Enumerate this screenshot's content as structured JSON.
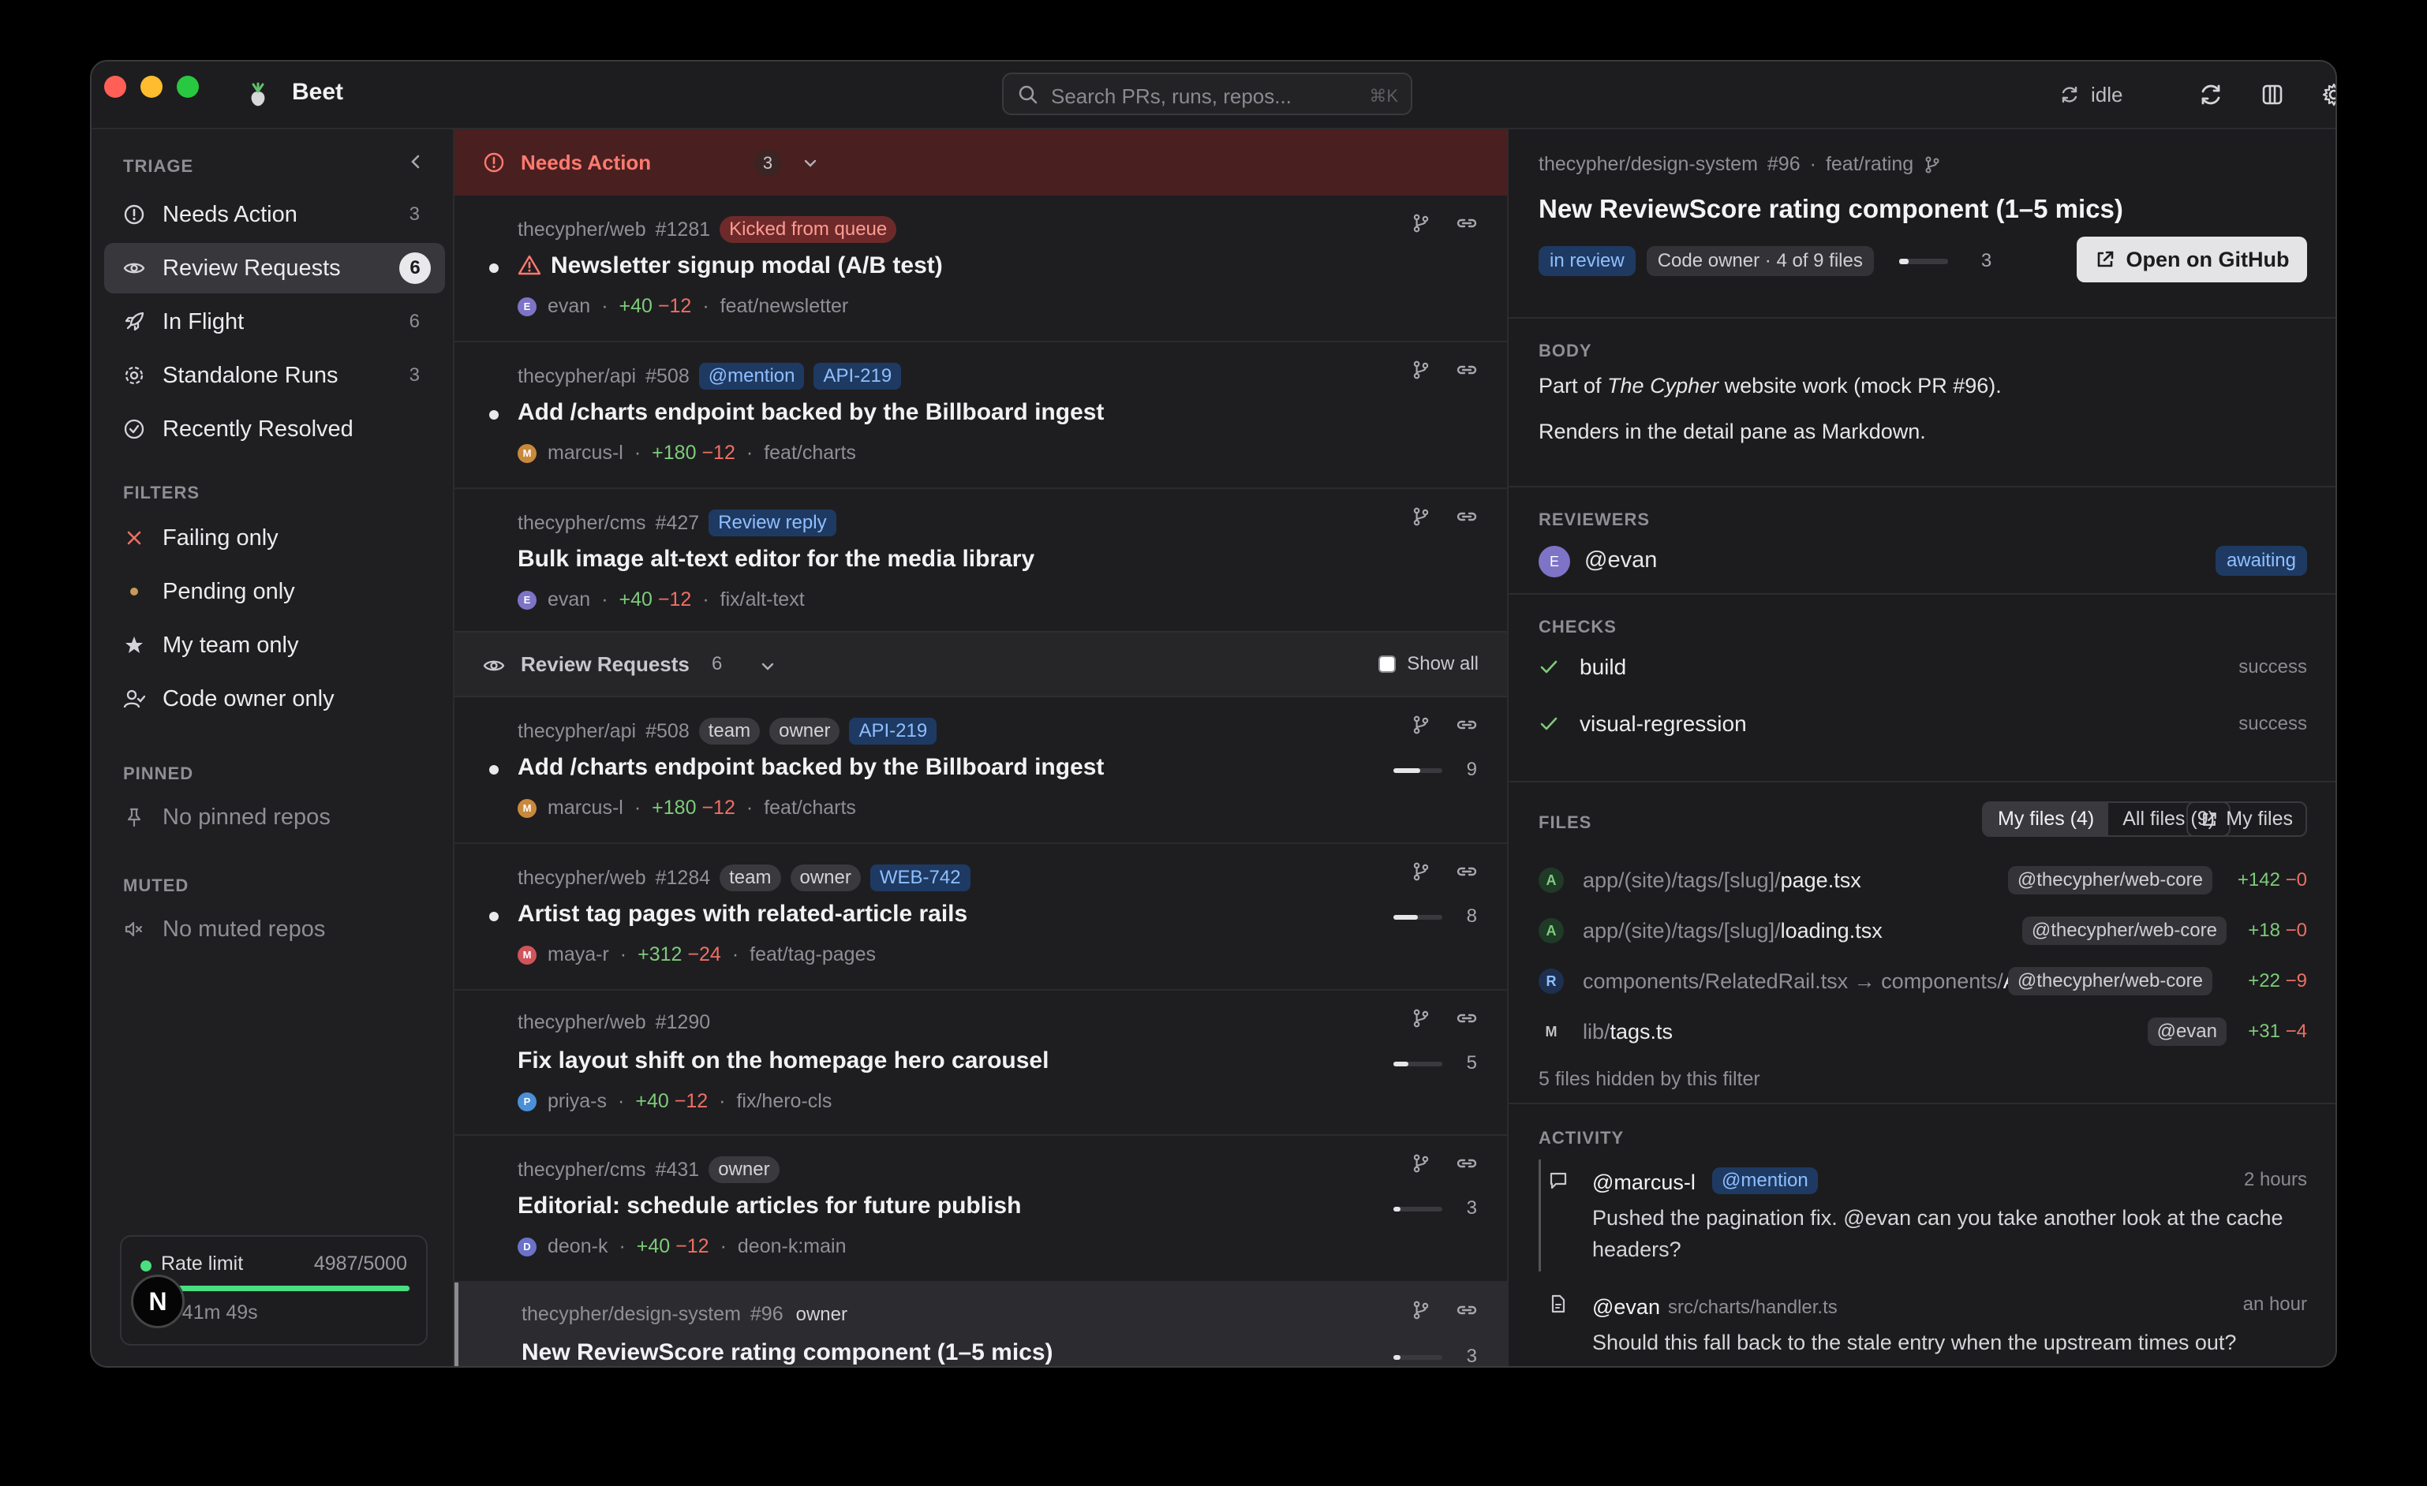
{
  "app": {
    "name": "Beet"
  },
  "search": {
    "placeholder": "Search PRs, runs, repos...",
    "shortcut": "⌘K"
  },
  "toolbar": {
    "status": "idle"
  },
  "sidebar": {
    "triage_title": "TRIAGE",
    "triage": [
      {
        "label": "Needs Action",
        "count": "3"
      },
      {
        "label": "Review Requests",
        "count": "6"
      },
      {
        "label": "In Flight",
        "count": "6"
      },
      {
        "label": "Standalone Runs",
        "count": "3"
      },
      {
        "label": "Recently Resolved",
        "count": ""
      }
    ],
    "filters_title": "FILTERS",
    "filters": [
      {
        "label": "Failing only"
      },
      {
        "label": "Pending only"
      },
      {
        "label": "My team only"
      },
      {
        "label": "Code owner only"
      }
    ],
    "pinned_title": "PINNED",
    "pinned_empty": "No pinned repos",
    "muted_title": "MUTED",
    "muted_empty": "No muted repos",
    "rate": {
      "label": "Rate limit",
      "value": "4987/5000",
      "used_fraction": 0.9974,
      "reset": "ts in 41m 49s",
      "avatar": "N"
    }
  },
  "list": {
    "needs_action": {
      "label": "Needs Action",
      "count": "3"
    },
    "needs_items": [
      {
        "repo": "thecypher/web",
        "num": "#1281",
        "tags": [
          {
            "text": "Kicked from queue",
            "kind": "red"
          }
        ],
        "title": "Newsletter signup modal (A/B test)",
        "author": "evan",
        "avatar": "E",
        "avatar_color": "#7d74c7",
        "plus": "+40",
        "minus": "−12",
        "branch": "feat/newsletter",
        "warn": true,
        "unread": true
      },
      {
        "repo": "thecypher/api",
        "num": "#508",
        "tags": [
          {
            "text": "@mention",
            "kind": "blue"
          },
          {
            "text": "API-219",
            "kind": "blue"
          }
        ],
        "title": "Add /charts endpoint backed by the Billboard ingest",
        "author": "marcus-l",
        "avatar": "M",
        "avatar_color": "#c9893c",
        "plus": "+180",
        "minus": "−12",
        "branch": "feat/charts",
        "unread": true
      },
      {
        "repo": "thecypher/cms",
        "num": "#427",
        "tags": [
          {
            "text": "Review reply",
            "kind": "blue"
          }
        ],
        "title": "Bulk image alt-text editor for the media library",
        "author": "evan",
        "avatar": "E",
        "avatar_color": "#7d74c7",
        "plus": "+40",
        "minus": "−12",
        "branch": "fix/alt-text"
      }
    ],
    "review_requests": {
      "label": "Review Requests",
      "count": "6",
      "show_all": "Show all"
    },
    "review_items": [
      {
        "repo": "thecypher/api",
        "num": "#508",
        "tags": [
          {
            "text": "team",
            "kind": "gray"
          },
          {
            "text": "owner",
            "kind": "gray"
          },
          {
            "text": "API-219",
            "kind": "blue"
          }
        ],
        "title": "Add /charts endpoint backed by the Billboard ingest",
        "author": "marcus-l",
        "avatar": "M",
        "avatar_color": "#c9893c",
        "plus": "+180",
        "minus": "−12",
        "branch": "feat/charts",
        "size": "9",
        "size_fraction": 0.55,
        "unread": true
      },
      {
        "repo": "thecypher/web",
        "num": "#1284",
        "tags": [
          {
            "text": "team",
            "kind": "gray"
          },
          {
            "text": "owner",
            "kind": "gray"
          },
          {
            "text": "WEB-742",
            "kind": "blue"
          }
        ],
        "title": "Artist tag pages with related-article rails",
        "author": "maya-r",
        "avatar": "M",
        "avatar_color": "#d0545a",
        "plus": "+312",
        "minus": "−24",
        "branch": "feat/tag-pages",
        "size": "8",
        "size_fraction": 0.5,
        "unread": true
      },
      {
        "repo": "thecypher/web",
        "num": "#1290",
        "tags": [],
        "title": "Fix layout shift on the homepage hero carousel",
        "author": "priya-s",
        "avatar": "P",
        "avatar_color": "#4b8fd6",
        "plus": "+40",
        "minus": "−12",
        "branch": "fix/hero-cls",
        "size": "5",
        "size_fraction": 0.3
      },
      {
        "repo": "thecypher/cms",
        "num": "#431",
        "tags": [
          {
            "text": "owner",
            "kind": "gray"
          }
        ],
        "title": "Editorial: schedule articles for future publish",
        "author": "deon-k",
        "avatar": "D",
        "avatar_color": "#6a72c9",
        "plus": "+40",
        "minus": "−12",
        "branch": "deon-k:main",
        "size": "3",
        "size_fraction": 0.15
      },
      {
        "repo": "thecypher/design-system",
        "num": "#96",
        "tags": [
          {
            "text": "owner",
            "kind": "plain"
          }
        ],
        "title": "New ReviewScore rating component (1–5 mics)",
        "size": "3",
        "size_fraction": 0.15,
        "selected": true
      }
    ]
  },
  "detail": {
    "repo": "thecypher/design-system",
    "num": "#96",
    "branch": "feat/rating",
    "title": "New ReviewScore rating component (1–5 mics)",
    "state": "in review",
    "owner_badge": "Code owner · 4 of 9 files",
    "progress_count": "3",
    "progress_fraction": 0.2,
    "open_button": "Open on GitHub",
    "body_label": "BODY",
    "body_line1_a": "Part of ",
    "body_line1_em": "The Cypher",
    "body_line1_b": " website work (mock PR #96).",
    "body_line2": "Renders in the detail pane as Markdown.",
    "reviewers_label": "REVIEWERS",
    "reviewer": {
      "name": "@evan",
      "avatar": "E",
      "status": "awaiting"
    },
    "checks_label": "CHECKS",
    "checks": [
      {
        "name": "build",
        "status": "success"
      },
      {
        "name": "visual-regression",
        "status": "success"
      }
    ],
    "files_label": "FILES",
    "files_tabs": [
      "My files (4)",
      "All files (9)"
    ],
    "files_button": "My files",
    "files": [
      {
        "status": "A",
        "dir": "app/(site)/tags/[slug]/",
        "name": "page.tsx",
        "owner": "@thecypher/web-core",
        "plus": "+142",
        "minus": "−0"
      },
      {
        "status": "A",
        "dir": "app/(site)/tags/[slug]/",
        "name": "loading.tsx",
        "owner": "@thecypher/web-core",
        "plus": "+18",
        "minus": "−0"
      },
      {
        "status": "R",
        "dir": "components/RelatedRail.tsx → components/",
        "name": "A...",
        "owner": "@thecypher/web-core",
        "plus": "+22",
        "minus": "−9"
      },
      {
        "status": "M",
        "dir": "lib/",
        "name": "tags.ts",
        "owner": "@evan",
        "plus": "+31",
        "minus": "−4"
      }
    ],
    "files_hidden": "5 files hidden by this filter",
    "activity_label": "ACTIVITY",
    "activity": [
      {
        "author": "@marcus-l",
        "badge": "@mention",
        "time": "2 hours",
        "body": "Pushed the pagination fix. @evan can you take another look at the cache headers?"
      },
      {
        "author": "@evan",
        "file": "src/charts/handler.ts",
        "time": "an hour",
        "body": "Should this fall back to the stale entry when the upstream times out?"
      }
    ]
  },
  "colors": {
    "accent_blue": "#8fbfff",
    "danger": "#ff7a70",
    "success": "#7ecb7a",
    "alert_bg": "#4a1f1f"
  }
}
